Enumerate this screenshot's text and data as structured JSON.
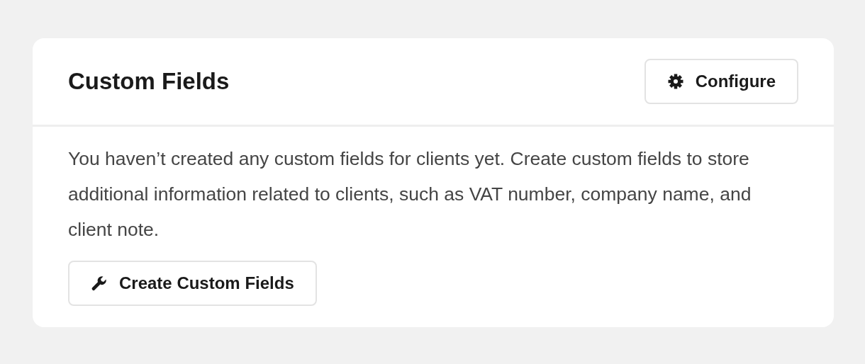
{
  "card": {
    "title": "Custom Fields",
    "header_button": {
      "label": "Configure"
    },
    "message": "You haven’t created any custom fields for clients yet. Create custom fields to store additional information related to clients, such as VAT number, company name, and client note.",
    "action_button": {
      "label": "Create Custom Fields"
    }
  }
}
